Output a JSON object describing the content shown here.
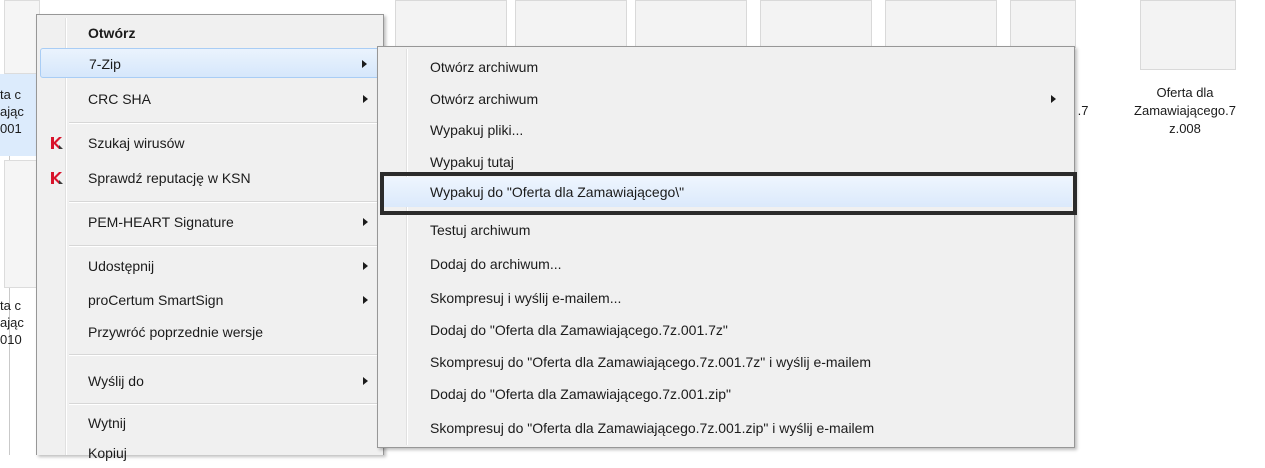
{
  "background": {
    "right_file": {
      "line1": "Oferta dla",
      "line2": "Zamawiającego.7",
      "line3": "z.008"
    },
    "partial_file_1": {
      "line1": "ta c",
      "line2": "ając",
      "line3": "001"
    },
    "partial_file_2": {
      "line1": "ta c",
      "line2": "ając",
      "line3": "010"
    },
    "partial_suffix": ".7"
  },
  "context_menu": {
    "items": [
      {
        "label": "Otwórz",
        "bold": true
      },
      {
        "label": "7-Zip",
        "submenu": true,
        "highlighted": true
      },
      {
        "label": "CRC SHA",
        "submenu": true
      },
      {
        "label": "Szukaj wirusów",
        "icon": "kaspersky-icon"
      },
      {
        "label": "Sprawdź reputację w KSN",
        "icon": "kaspersky-icon"
      },
      {
        "label": "PEM-HEART Signature",
        "submenu": true
      },
      {
        "label": "Udostępnij",
        "submenu": true
      },
      {
        "label": "proCertum SmartSign",
        "submenu": true
      },
      {
        "label": "Przywróć poprzednie wersje"
      },
      {
        "label": "Wyślij do",
        "submenu": true
      },
      {
        "label": "Wytnij"
      },
      {
        "label": "Kopiuj"
      }
    ]
  },
  "submenu_7zip": {
    "items": [
      {
        "label": "Otwórz archiwum"
      },
      {
        "label": "Otwórz archiwum",
        "submenu": true
      },
      {
        "label": "Wypakuj pliki..."
      },
      {
        "label": "Wypakuj tutaj"
      },
      {
        "label": "Wypakuj do \"Oferta dla Zamawiającego\\\"",
        "highlighted": true
      },
      {
        "label": "Testuj archiwum"
      },
      {
        "label": "Dodaj do archiwum..."
      },
      {
        "label": "Skompresuj i wyślij e-mailem..."
      },
      {
        "label": "Dodaj do \"Oferta dla Zamawiającego.7z.001.7z\""
      },
      {
        "label": "Skompresuj do \"Oferta dla Zamawiającego.7z.001.7z\" i wyślij e-mailem"
      },
      {
        "label": "Dodaj do \"Oferta dla Zamawiającego.7z.001.zip\""
      },
      {
        "label": "Skompresuj do \"Oferta dla Zamawiającego.7z.001.zip\" i wyślij e-mailem"
      }
    ]
  },
  "colors": {
    "highlight": "#d6e7fb",
    "callout_border": "#2b2b2b",
    "kaspersky_red": "#d8132b"
  }
}
